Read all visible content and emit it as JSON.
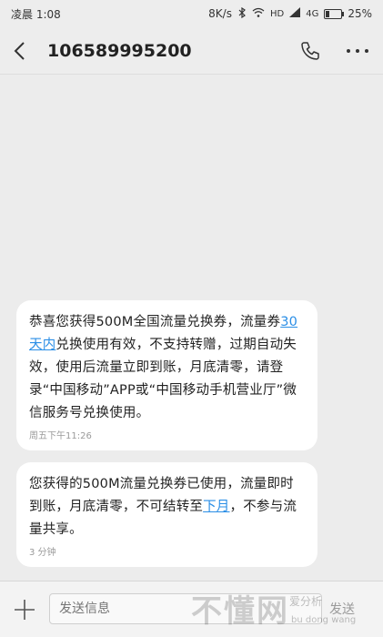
{
  "status": {
    "time": "凌晨 1:08",
    "speed": "8K/s",
    "network_hd": "HD",
    "network": "4G",
    "battery": "25%",
    "battery_level": 0.25
  },
  "header": {
    "title": "106589995200"
  },
  "messages": [
    {
      "parts": [
        "恭喜您获得500M全国流量兑换券，流量券",
        "30天内",
        "兑换使用有效，不支持转赠，过期自动失效，使用后流量立即到账，月底清零，请登录“中国移动”APP或“中国移动手机营业厅”微信服务号兑换使用。"
      ],
      "time": "周五下午11:26"
    },
    {
      "parts": [
        "您获得的500M流量兑换券已使用，流量即时到账，月底清零，不可结转至",
        "下月",
        "，不参与流量共享。"
      ],
      "time": "3 分钟"
    }
  ],
  "composer": {
    "placeholder": "发送信息",
    "send_label": "发送"
  },
  "watermark": {
    "main": "不懂网",
    "sub": "爱分析",
    "sub2": "bu dong wang"
  }
}
